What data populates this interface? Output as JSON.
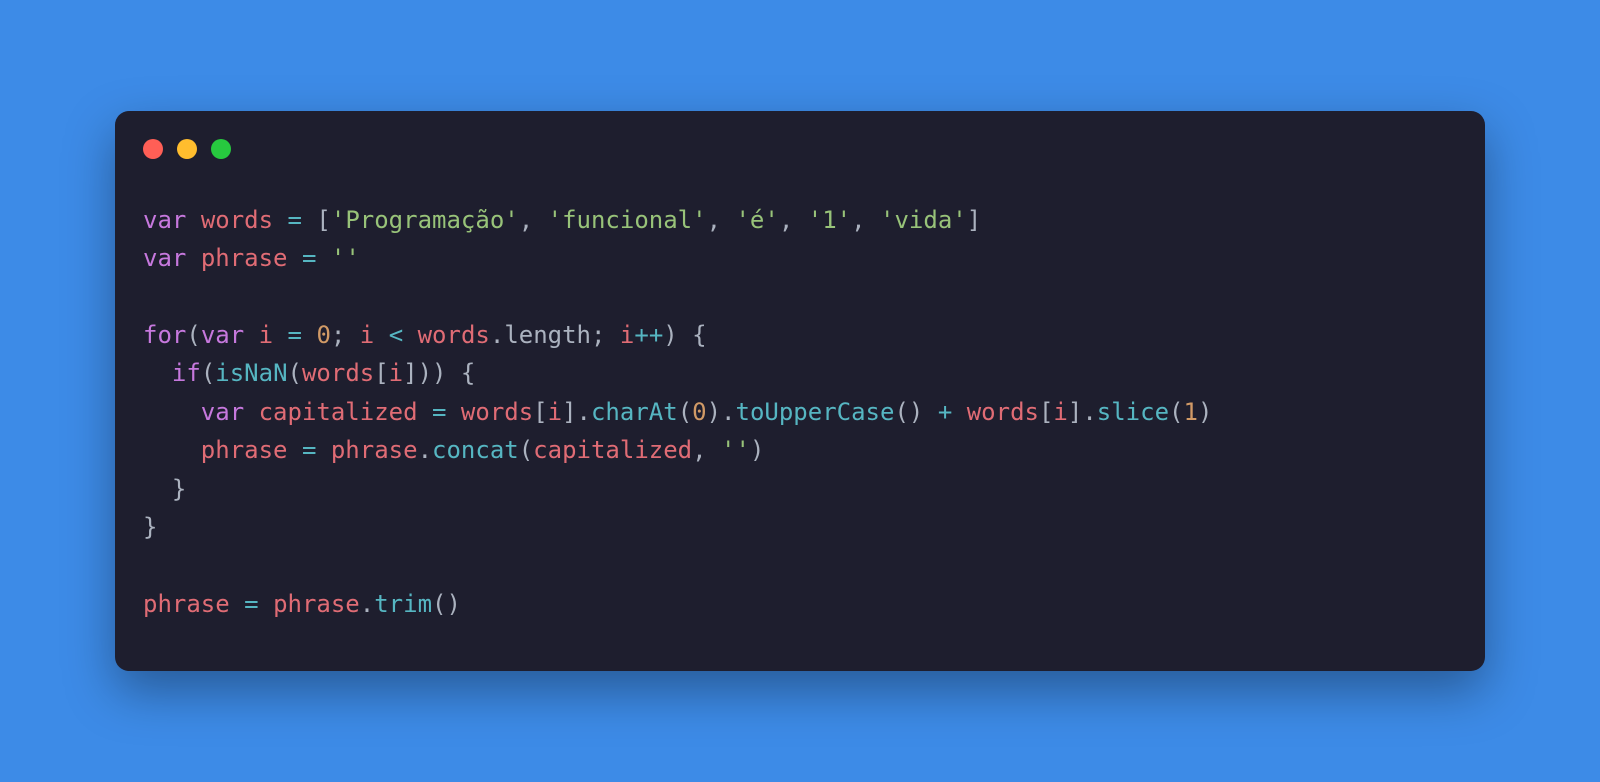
{
  "window": {
    "traffic_lights": {
      "red": "#ff5f56",
      "yellow": "#ffbd2e",
      "green": "#27c93f"
    }
  },
  "code": {
    "tokens": [
      {
        "t": "kw",
        "v": "var"
      },
      {
        "t": "plain",
        "v": " "
      },
      {
        "t": "ident",
        "v": "words"
      },
      {
        "t": "plain",
        "v": " "
      },
      {
        "t": "op",
        "v": "="
      },
      {
        "t": "plain",
        "v": " ["
      },
      {
        "t": "str",
        "v": "'Programação'"
      },
      {
        "t": "plain",
        "v": ", "
      },
      {
        "t": "str",
        "v": "'funcional'"
      },
      {
        "t": "plain",
        "v": ", "
      },
      {
        "t": "str",
        "v": "'é'"
      },
      {
        "t": "plain",
        "v": ", "
      },
      {
        "t": "str",
        "v": "'1'"
      },
      {
        "t": "plain",
        "v": ", "
      },
      {
        "t": "str",
        "v": "'vida'"
      },
      {
        "t": "plain",
        "v": "]"
      },
      {
        "t": "nl"
      },
      {
        "t": "kw",
        "v": "var"
      },
      {
        "t": "plain",
        "v": " "
      },
      {
        "t": "ident",
        "v": "phrase"
      },
      {
        "t": "plain",
        "v": " "
      },
      {
        "t": "op",
        "v": "="
      },
      {
        "t": "plain",
        "v": " "
      },
      {
        "t": "str",
        "v": "''"
      },
      {
        "t": "nl"
      },
      {
        "t": "nl"
      },
      {
        "t": "kw",
        "v": "for"
      },
      {
        "t": "plain",
        "v": "("
      },
      {
        "t": "kw",
        "v": "var"
      },
      {
        "t": "plain",
        "v": " "
      },
      {
        "t": "ident",
        "v": "i"
      },
      {
        "t": "plain",
        "v": " "
      },
      {
        "t": "op",
        "v": "="
      },
      {
        "t": "plain",
        "v": " "
      },
      {
        "t": "num",
        "v": "0"
      },
      {
        "t": "plain",
        "v": "; "
      },
      {
        "t": "ident",
        "v": "i"
      },
      {
        "t": "plain",
        "v": " "
      },
      {
        "t": "op",
        "v": "<"
      },
      {
        "t": "plain",
        "v": " "
      },
      {
        "t": "ident",
        "v": "words"
      },
      {
        "t": "plain",
        "v": "."
      },
      {
        "t": "prop",
        "v": "length"
      },
      {
        "t": "plain",
        "v": "; "
      },
      {
        "t": "ident",
        "v": "i"
      },
      {
        "t": "op",
        "v": "++"
      },
      {
        "t": "plain",
        "v": ") {"
      },
      {
        "t": "nl"
      },
      {
        "t": "plain",
        "v": "  "
      },
      {
        "t": "kw",
        "v": "if"
      },
      {
        "t": "plain",
        "v": "("
      },
      {
        "t": "call",
        "v": "isNaN"
      },
      {
        "t": "plain",
        "v": "("
      },
      {
        "t": "ident",
        "v": "words"
      },
      {
        "t": "plain",
        "v": "["
      },
      {
        "t": "ident",
        "v": "i"
      },
      {
        "t": "plain",
        "v": "])) {"
      },
      {
        "t": "nl"
      },
      {
        "t": "plain",
        "v": "    "
      },
      {
        "t": "kw",
        "v": "var"
      },
      {
        "t": "plain",
        "v": " "
      },
      {
        "t": "ident",
        "v": "capitalized"
      },
      {
        "t": "plain",
        "v": " "
      },
      {
        "t": "op",
        "v": "="
      },
      {
        "t": "plain",
        "v": " "
      },
      {
        "t": "ident",
        "v": "words"
      },
      {
        "t": "plain",
        "v": "["
      },
      {
        "t": "ident",
        "v": "i"
      },
      {
        "t": "plain",
        "v": "]."
      },
      {
        "t": "call",
        "v": "charAt"
      },
      {
        "t": "plain",
        "v": "("
      },
      {
        "t": "num",
        "v": "0"
      },
      {
        "t": "plain",
        "v": ")."
      },
      {
        "t": "call",
        "v": "toUpperCase"
      },
      {
        "t": "plain",
        "v": "() "
      },
      {
        "t": "op",
        "v": "+"
      },
      {
        "t": "plain",
        "v": " "
      },
      {
        "t": "ident",
        "v": "words"
      },
      {
        "t": "plain",
        "v": "["
      },
      {
        "t": "ident",
        "v": "i"
      },
      {
        "t": "plain",
        "v": "]."
      },
      {
        "t": "call",
        "v": "slice"
      },
      {
        "t": "plain",
        "v": "("
      },
      {
        "t": "num",
        "v": "1"
      },
      {
        "t": "plain",
        "v": ")"
      },
      {
        "t": "nl"
      },
      {
        "t": "plain",
        "v": "    "
      },
      {
        "t": "ident",
        "v": "phrase"
      },
      {
        "t": "plain",
        "v": " "
      },
      {
        "t": "op",
        "v": "="
      },
      {
        "t": "plain",
        "v": " "
      },
      {
        "t": "ident",
        "v": "phrase"
      },
      {
        "t": "plain",
        "v": "."
      },
      {
        "t": "call",
        "v": "concat"
      },
      {
        "t": "plain",
        "v": "("
      },
      {
        "t": "ident",
        "v": "capitalized"
      },
      {
        "t": "plain",
        "v": ", "
      },
      {
        "t": "str",
        "v": "''"
      },
      {
        "t": "plain",
        "v": ")"
      },
      {
        "t": "nl"
      },
      {
        "t": "plain",
        "v": "  }"
      },
      {
        "t": "nl"
      },
      {
        "t": "plain",
        "v": "}"
      },
      {
        "t": "nl"
      },
      {
        "t": "nl"
      },
      {
        "t": "ident",
        "v": "phrase"
      },
      {
        "t": "plain",
        "v": " "
      },
      {
        "t": "op",
        "v": "="
      },
      {
        "t": "plain",
        "v": " "
      },
      {
        "t": "ident",
        "v": "phrase"
      },
      {
        "t": "plain",
        "v": "."
      },
      {
        "t": "call",
        "v": "trim"
      },
      {
        "t": "plain",
        "v": "()"
      }
    ]
  }
}
